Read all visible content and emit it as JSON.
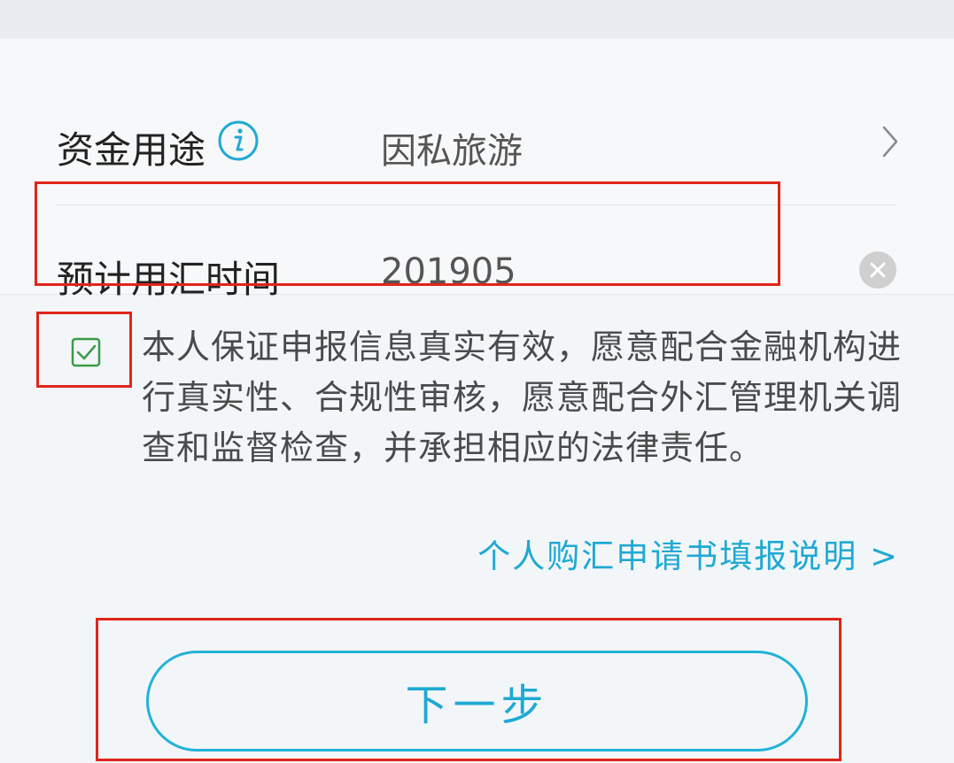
{
  "form": {
    "purpose": {
      "label": "资金用途",
      "value": "因私旅游",
      "info_icon": "info-icon",
      "arrow_icon": "chevron-right-icon"
    },
    "exchange_time": {
      "label": "预计用汇时间",
      "value": "201905",
      "clear_icon": "clear-icon"
    }
  },
  "agreement": {
    "checked": true,
    "text": "本人保证申报信息真实有效，愿意配合金融机构进行真实性、合规性审核，愿意配合外汇管理机关调查和监督检查，并承担相应的法律责任。"
  },
  "guide_link": "个人购汇申请书填报说明 >",
  "next_button": "下一步",
  "colors": {
    "accent": "#1fa9d3",
    "highlight_box": "#e0251b",
    "checkbox": "#3a9b4a"
  }
}
